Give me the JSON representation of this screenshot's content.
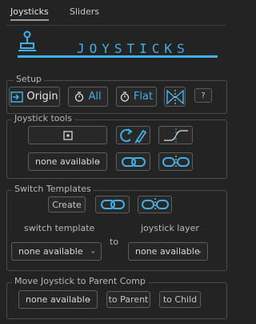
{
  "tabs": [
    {
      "label": "Joysticks",
      "active": true
    },
    {
      "label": "Sliders",
      "active": false
    }
  ],
  "header": {
    "title": "JOYSTICKS",
    "accent_color": "#3fb0e8"
  },
  "setup": {
    "title": "Setup",
    "origin_label": "Origin",
    "all_label": "All",
    "flat_label": "Flat",
    "help_label": "?"
  },
  "joystick_tools": {
    "title": "Joystick tools",
    "dropdown_value": "none available"
  },
  "switch_templates": {
    "title": "Switch Templates",
    "create_label": "Create",
    "switch_template_label": "switch template",
    "to_label": "to",
    "joystick_layer_label": "joystick layer",
    "template_value": "none available",
    "layer_value": "none available"
  },
  "move_joystick": {
    "title": "Move Joystick to Parent Comp",
    "dropdown_value": "none available",
    "to_parent_label": "to Parent",
    "to_child_label": "to Child"
  }
}
